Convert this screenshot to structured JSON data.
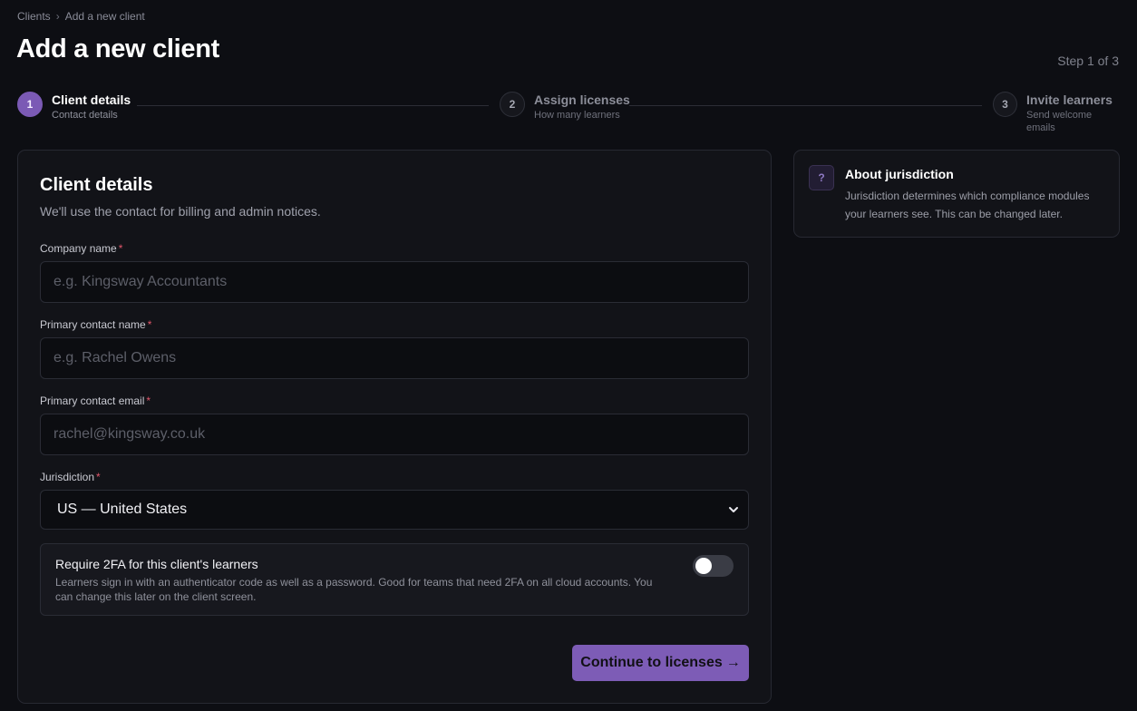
{
  "breadcrumb": {
    "parent": "Clients",
    "separator": "›",
    "current": "Add a new client"
  },
  "page": {
    "title": "Add a new client",
    "step_count": "Step 1 of 3"
  },
  "stepper": {
    "steps": [
      {
        "number": "1",
        "title": "Client details",
        "subtitle": "Contact details",
        "state": "active"
      },
      {
        "number": "2",
        "title": "Assign licenses",
        "subtitle": "How many learners",
        "state": "pending"
      },
      {
        "number": "3",
        "title": "Invite learners",
        "subtitle": "Send welcome emails",
        "state": "pending"
      }
    ]
  },
  "form": {
    "title": "Client details",
    "subtitle": "We'll use the contact for billing and admin notices.",
    "required_mark": "*",
    "company": {
      "label": "Company name",
      "placeholder": "e.g. Kingsway Accountants",
      "value": ""
    },
    "contact_name": {
      "label": "Primary contact name",
      "placeholder": "e.g. Rachel Owens",
      "value": ""
    },
    "contact_email": {
      "label": "Primary contact email",
      "placeholder": "rachel@kingsway.co.uk",
      "value": ""
    },
    "jurisdiction": {
      "label": "Jurisdiction",
      "selected": "US — United States"
    },
    "twofa": {
      "title": "Require 2FA for this client's learners",
      "description": "Learners sign in with an authenticator code as well as a password. Good for teams that need 2FA on all cloud accounts. You can change this later on the client screen.",
      "enabled": false
    },
    "continue_label": "Continue to licenses",
    "continue_arrow": "→"
  },
  "about": {
    "icon_glyph": "?",
    "title": "About jurisdiction",
    "body": "Jurisdiction determines which compliance modules your learners see. This can be changed later."
  },
  "colors": {
    "accent": "#7d5cb6",
    "background": "#0d0e13",
    "card": "#121318",
    "required": "#e0566a"
  },
  "icons": {
    "select": "chevron-down-icon",
    "about": "question-icon",
    "continue": "arrow-right-icon"
  }
}
